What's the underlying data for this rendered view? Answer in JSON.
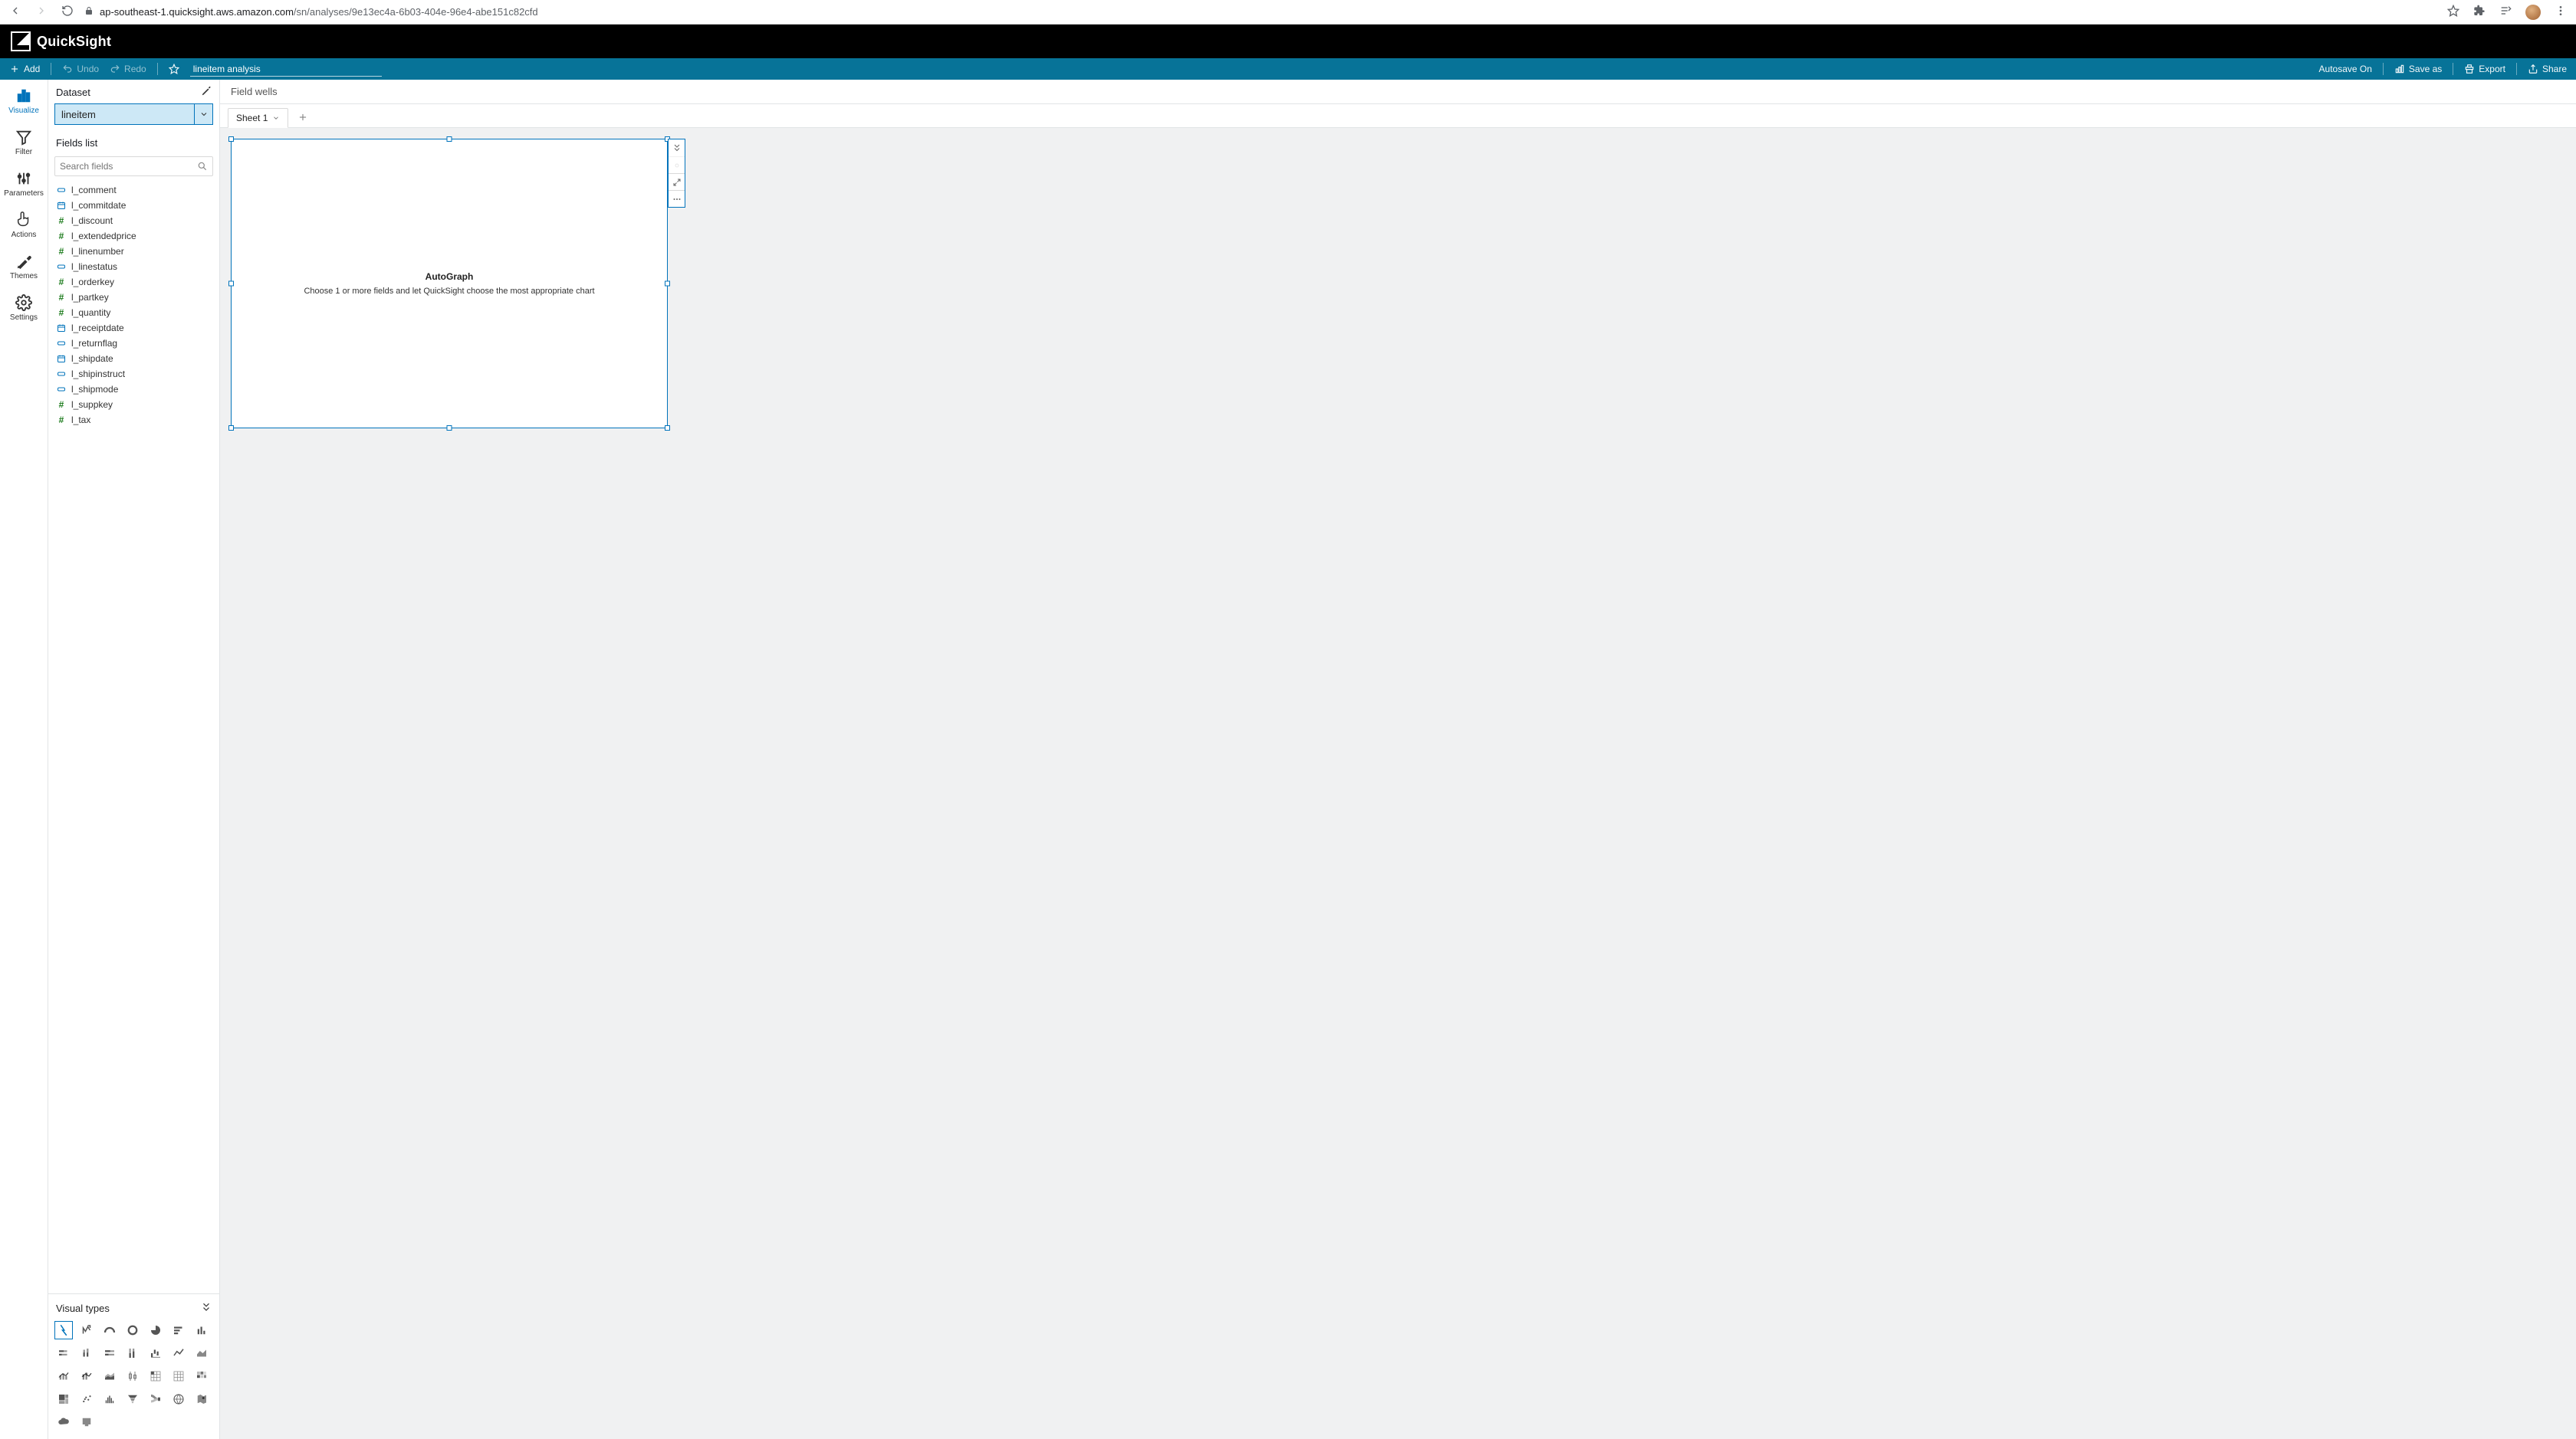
{
  "browser": {
    "host": "ap-southeast-1.quicksight.aws.amazon.com",
    "path": "/sn/analyses/9e13ec4a-6b03-404e-96e4-abe151c82cfd"
  },
  "app": {
    "name": "QuickSight"
  },
  "toolbar": {
    "add": "Add",
    "undo": "Undo",
    "redo": "Redo",
    "analysis_name": "lineitem analysis",
    "autosave": "Autosave On",
    "saveas": "Save as",
    "export": "Export",
    "share": "Share"
  },
  "rail": {
    "visualize": "Visualize",
    "filter": "Filter",
    "parameters": "Parameters",
    "actions": "Actions",
    "themes": "Themes",
    "settings": "Settings"
  },
  "panel": {
    "dataset_label": "Dataset",
    "dataset_value": "lineitem",
    "fields_list_label": "Fields list",
    "search_placeholder": "Search fields",
    "visual_types_label": "Visual types"
  },
  "fields": [
    {
      "name": "l_comment",
      "type": "string"
    },
    {
      "name": "l_commitdate",
      "type": "date"
    },
    {
      "name": "l_discount",
      "type": "number"
    },
    {
      "name": "l_extendedprice",
      "type": "number"
    },
    {
      "name": "l_linenumber",
      "type": "number"
    },
    {
      "name": "l_linestatus",
      "type": "string"
    },
    {
      "name": "l_orderkey",
      "type": "number"
    },
    {
      "name": "l_partkey",
      "type": "number"
    },
    {
      "name": "l_quantity",
      "type": "number"
    },
    {
      "name": "l_receiptdate",
      "type": "date"
    },
    {
      "name": "l_returnflag",
      "type": "string"
    },
    {
      "name": "l_shipdate",
      "type": "date"
    },
    {
      "name": "l_shipinstruct",
      "type": "string"
    },
    {
      "name": "l_shipmode",
      "type": "string"
    },
    {
      "name": "l_suppkey",
      "type": "number"
    },
    {
      "name": "l_tax",
      "type": "number"
    }
  ],
  "canvas": {
    "field_wells_label": "Field wells",
    "sheet_tab": "Sheet 1",
    "autograph_title": "AutoGraph",
    "autograph_sub": "Choose 1 or more fields and let QuickSight choose the most appropriate chart"
  }
}
